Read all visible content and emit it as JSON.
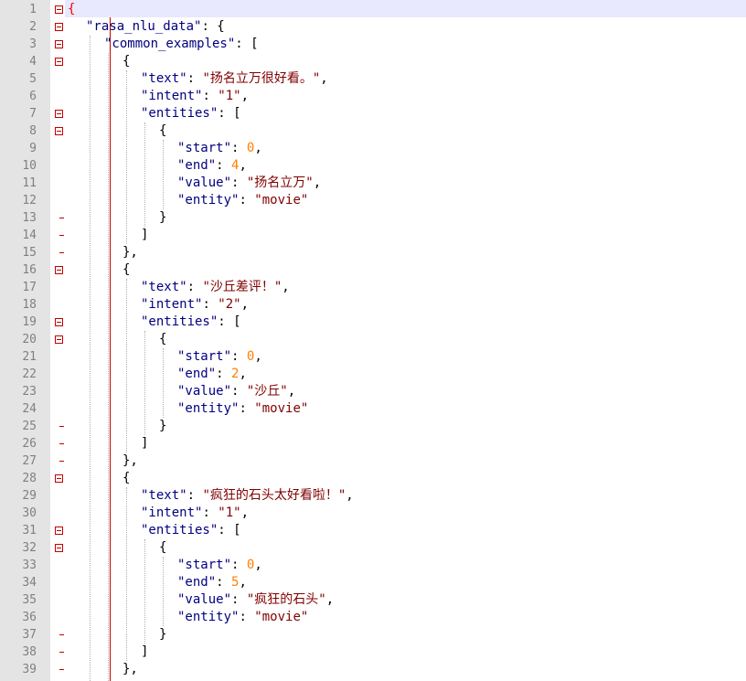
{
  "editor": {
    "colors": {
      "gutter_bg": "#e4e4e4",
      "fold_marker": "#c00000",
      "current_line": "#e8e8ff",
      "key": "#000080",
      "string": "#800000",
      "number": "#ff8000",
      "operator": "#000000"
    },
    "gutter": {
      "line_numbers": [
        "1",
        "2",
        "3",
        "4",
        "5",
        "6",
        "7",
        "8",
        "9",
        "10",
        "11",
        "12",
        "13",
        "14",
        "15",
        "16",
        "17",
        "18",
        "19",
        "20",
        "21",
        "22",
        "23",
        "24",
        "25",
        "26",
        "27",
        "28",
        "29",
        "30",
        "31",
        "32",
        "33",
        "34",
        "35",
        "36",
        "37",
        "38",
        "39"
      ]
    },
    "lines": [
      {
        "indent": 0,
        "tokens": [
          {
            "t": "{",
            "k": "brace-hl"
          }
        ]
      },
      {
        "indent": 1,
        "tokens": [
          {
            "t": "\"rasa_nlu_data\"",
            "k": "key"
          },
          {
            "t": ": {",
            "k": "op"
          }
        ]
      },
      {
        "indent": 2,
        "tokens": [
          {
            "t": "\"common_examples\"",
            "k": "key"
          },
          {
            "t": ": [",
            "k": "op"
          }
        ]
      },
      {
        "indent": 3,
        "tokens": [
          {
            "t": "{",
            "k": "op"
          }
        ]
      },
      {
        "indent": 4,
        "tokens": [
          {
            "t": "\"text\"",
            "k": "key"
          },
          {
            "t": ": ",
            "k": "op"
          },
          {
            "t": "\"扬名立万很好看。\"",
            "k": "str"
          },
          {
            "t": ",",
            "k": "op"
          }
        ]
      },
      {
        "indent": 4,
        "tokens": [
          {
            "t": "\"intent\"",
            "k": "key"
          },
          {
            "t": ": ",
            "k": "op"
          },
          {
            "t": "\"1\"",
            "k": "str"
          },
          {
            "t": ",",
            "k": "op"
          }
        ]
      },
      {
        "indent": 4,
        "tokens": [
          {
            "t": "\"entities\"",
            "k": "key"
          },
          {
            "t": ": [",
            "k": "op"
          }
        ]
      },
      {
        "indent": 5,
        "tokens": [
          {
            "t": "{",
            "k": "op"
          }
        ]
      },
      {
        "indent": 6,
        "tokens": [
          {
            "t": "\"start\"",
            "k": "key"
          },
          {
            "t": ": ",
            "k": "op"
          },
          {
            "t": "0",
            "k": "num"
          },
          {
            "t": ",",
            "k": "op"
          }
        ]
      },
      {
        "indent": 6,
        "tokens": [
          {
            "t": "\"end\"",
            "k": "key"
          },
          {
            "t": ": ",
            "k": "op"
          },
          {
            "t": "4",
            "k": "num"
          },
          {
            "t": ",",
            "k": "op"
          }
        ]
      },
      {
        "indent": 6,
        "tokens": [
          {
            "t": "\"value\"",
            "k": "key"
          },
          {
            "t": ": ",
            "k": "op"
          },
          {
            "t": "\"扬名立万\"",
            "k": "str"
          },
          {
            "t": ",",
            "k": "op"
          }
        ]
      },
      {
        "indent": 6,
        "tokens": [
          {
            "t": "\"entity\"",
            "k": "key"
          },
          {
            "t": ": ",
            "k": "op"
          },
          {
            "t": "\"movie\"",
            "k": "str"
          }
        ]
      },
      {
        "indent": 5,
        "tokens": [
          {
            "t": "}",
            "k": "op"
          }
        ]
      },
      {
        "indent": 4,
        "tokens": [
          {
            "t": "]",
            "k": "op"
          }
        ]
      },
      {
        "indent": 3,
        "tokens": [
          {
            "t": "},",
            "k": "op"
          }
        ]
      },
      {
        "indent": 3,
        "tokens": [
          {
            "t": "{",
            "k": "op"
          }
        ]
      },
      {
        "indent": 4,
        "tokens": [
          {
            "t": "\"text\"",
            "k": "key"
          },
          {
            "t": ": ",
            "k": "op"
          },
          {
            "t": "\"沙丘差评！\"",
            "k": "str"
          },
          {
            "t": ",",
            "k": "op"
          }
        ]
      },
      {
        "indent": 4,
        "tokens": [
          {
            "t": "\"intent\"",
            "k": "key"
          },
          {
            "t": ": ",
            "k": "op"
          },
          {
            "t": "\"2\"",
            "k": "str"
          },
          {
            "t": ",",
            "k": "op"
          }
        ]
      },
      {
        "indent": 4,
        "tokens": [
          {
            "t": "\"entities\"",
            "k": "key"
          },
          {
            "t": ": [",
            "k": "op"
          }
        ]
      },
      {
        "indent": 5,
        "tokens": [
          {
            "t": "{",
            "k": "op"
          }
        ]
      },
      {
        "indent": 6,
        "tokens": [
          {
            "t": "\"start\"",
            "k": "key"
          },
          {
            "t": ": ",
            "k": "op"
          },
          {
            "t": "0",
            "k": "num"
          },
          {
            "t": ",",
            "k": "op"
          }
        ]
      },
      {
        "indent": 6,
        "tokens": [
          {
            "t": "\"end\"",
            "k": "key"
          },
          {
            "t": ": ",
            "k": "op"
          },
          {
            "t": "2",
            "k": "num"
          },
          {
            "t": ",",
            "k": "op"
          }
        ]
      },
      {
        "indent": 6,
        "tokens": [
          {
            "t": "\"value\"",
            "k": "key"
          },
          {
            "t": ": ",
            "k": "op"
          },
          {
            "t": "\"沙丘\"",
            "k": "str"
          },
          {
            "t": ",",
            "k": "op"
          }
        ]
      },
      {
        "indent": 6,
        "tokens": [
          {
            "t": "\"entity\"",
            "k": "key"
          },
          {
            "t": ": ",
            "k": "op"
          },
          {
            "t": "\"movie\"",
            "k": "str"
          }
        ]
      },
      {
        "indent": 5,
        "tokens": [
          {
            "t": "}",
            "k": "op"
          }
        ]
      },
      {
        "indent": 4,
        "tokens": [
          {
            "t": "]",
            "k": "op"
          }
        ]
      },
      {
        "indent": 3,
        "tokens": [
          {
            "t": "},",
            "k": "op"
          }
        ]
      },
      {
        "indent": 3,
        "tokens": [
          {
            "t": "{",
            "k": "op"
          }
        ]
      },
      {
        "indent": 4,
        "tokens": [
          {
            "t": "\"text\"",
            "k": "key"
          },
          {
            "t": ": ",
            "k": "op"
          },
          {
            "t": "\"疯狂的石头太好看啦！\"",
            "k": "str"
          },
          {
            "t": ",",
            "k": "op"
          }
        ]
      },
      {
        "indent": 4,
        "tokens": [
          {
            "t": "\"intent\"",
            "k": "key"
          },
          {
            "t": ": ",
            "k": "op"
          },
          {
            "t": "\"1\"",
            "k": "str"
          },
          {
            "t": ",",
            "k": "op"
          }
        ]
      },
      {
        "indent": 4,
        "tokens": [
          {
            "t": "\"entities\"",
            "k": "key"
          },
          {
            "t": ": [",
            "k": "op"
          }
        ]
      },
      {
        "indent": 5,
        "tokens": [
          {
            "t": "{",
            "k": "op"
          }
        ]
      },
      {
        "indent": 6,
        "tokens": [
          {
            "t": "\"start\"",
            "k": "key"
          },
          {
            "t": ": ",
            "k": "op"
          },
          {
            "t": "0",
            "k": "num"
          },
          {
            "t": ",",
            "k": "op"
          }
        ]
      },
      {
        "indent": 6,
        "tokens": [
          {
            "t": "\"end\"",
            "k": "key"
          },
          {
            "t": ": ",
            "k": "op"
          },
          {
            "t": "5",
            "k": "num"
          },
          {
            "t": ",",
            "k": "op"
          }
        ]
      },
      {
        "indent": 6,
        "tokens": [
          {
            "t": "\"value\"",
            "k": "key"
          },
          {
            "t": ": ",
            "k": "op"
          },
          {
            "t": "\"疯狂的石头\"",
            "k": "str"
          },
          {
            "t": ",",
            "k": "op"
          }
        ]
      },
      {
        "indent": 6,
        "tokens": [
          {
            "t": "\"entity\"",
            "k": "key"
          },
          {
            "t": ": ",
            "k": "op"
          },
          {
            "t": "\"movie\"",
            "k": "str"
          }
        ]
      },
      {
        "indent": 5,
        "tokens": [
          {
            "t": "}",
            "k": "op"
          }
        ]
      },
      {
        "indent": 4,
        "tokens": [
          {
            "t": "]",
            "k": "op"
          }
        ]
      },
      {
        "indent": 3,
        "tokens": [
          {
            "t": "},",
            "k": "op"
          }
        ]
      }
    ]
  }
}
